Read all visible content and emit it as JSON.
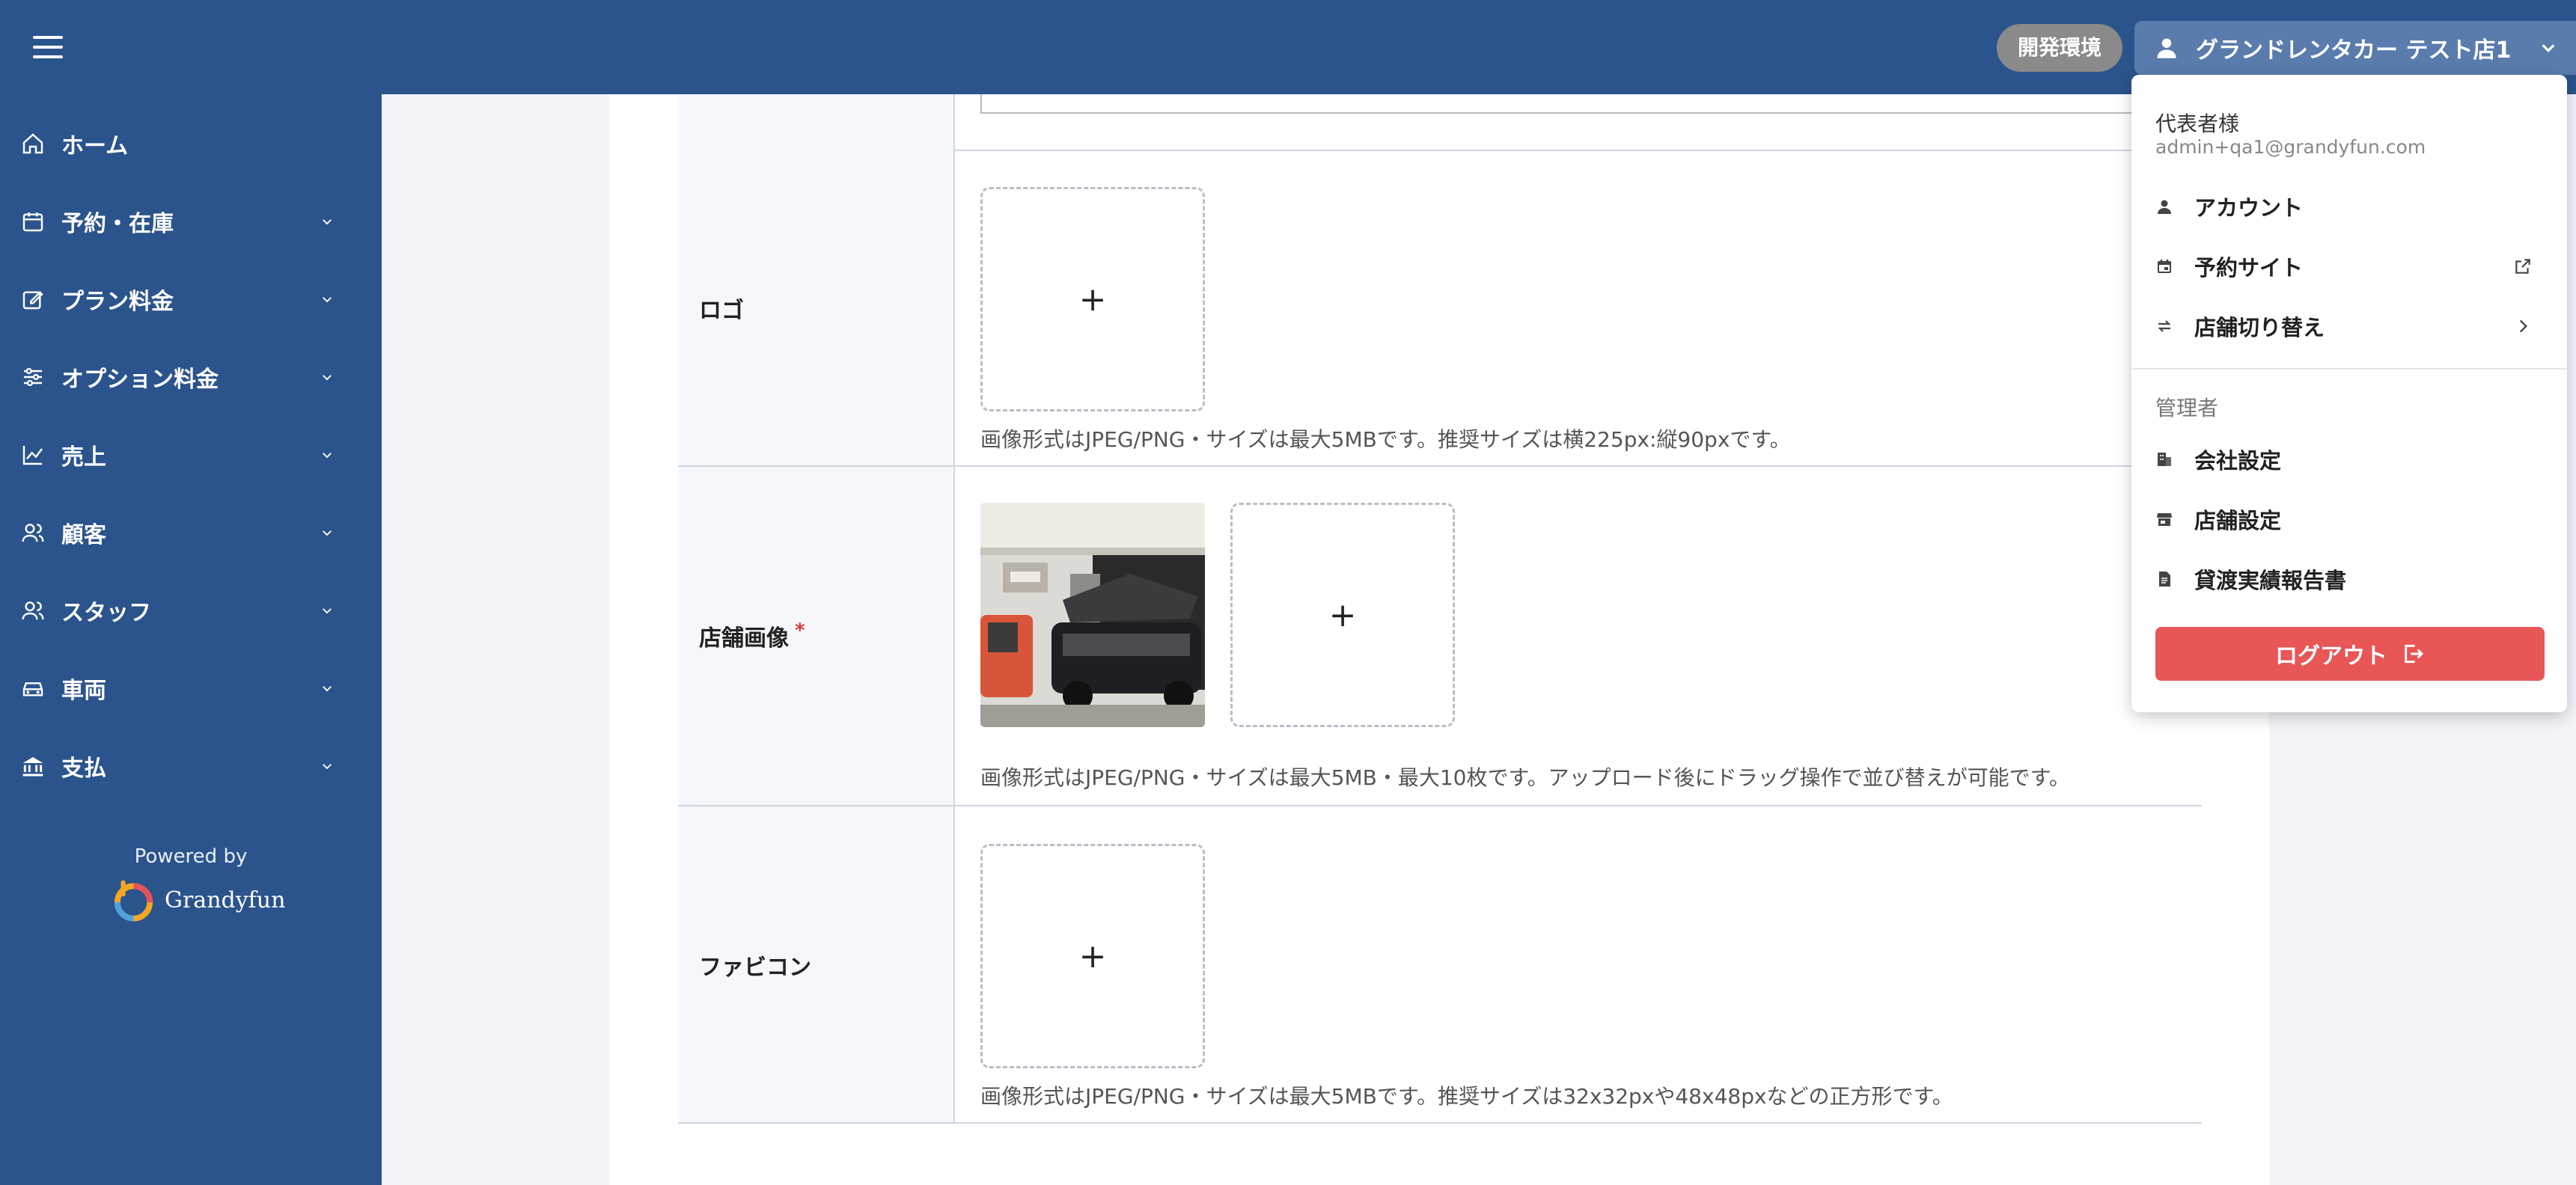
{
  "header": {
    "env_badge": "開発環境",
    "store_name": "グランドレンタカー テスト店1"
  },
  "sidebar": {
    "items": [
      {
        "label": "ホーム",
        "icon": "home-icon"
      },
      {
        "label": "予約・在庫",
        "icon": "calendar-icon"
      },
      {
        "label": "プラン料金",
        "icon": "edit-icon"
      },
      {
        "label": "オプション料金",
        "icon": "sliders-icon"
      },
      {
        "label": "売上",
        "icon": "chart-line-icon"
      },
      {
        "label": "顧客",
        "icon": "users-icon"
      },
      {
        "label": "スタッフ",
        "icon": "staff-icon"
      },
      {
        "label": "車両",
        "icon": "car-icon"
      },
      {
        "label": "支払",
        "icon": "bank-icon"
      }
    ],
    "powered_by": "Powered by",
    "brand": "Grandyfun"
  },
  "form": {
    "logo": {
      "label": "ロゴ",
      "hint": "画像形式はJPEG/PNG・サイズは最大5MBです。推奨サイズは横225px:縦90pxです。"
    },
    "store_image": {
      "label": "店舗画像",
      "required": "*",
      "hint": "画像形式はJPEG/PNG・サイズは最大5MB・最大10枚です。アップロード後にドラッグ操作で並び替えが可能です。"
    },
    "favicon": {
      "label": "ファビコン",
      "hint": "画像形式はJPEG/PNG・サイズは最大5MBです。推奨サイズは32x32pxや48x48pxなどの正方形です。"
    },
    "upload_plus": "+"
  },
  "dropdown": {
    "user_name": "代表者様",
    "email": "admin+qa1@grandyfun.com",
    "items": [
      {
        "label": "アカウント"
      },
      {
        "label": "予約サイト"
      },
      {
        "label": "店舗切り替え"
      }
    ],
    "admin_section": "管理者",
    "admin_items": [
      {
        "label": "会社設定"
      },
      {
        "label": "店舗設定"
      },
      {
        "label": "貸渡実績報告書"
      }
    ],
    "logout": "ログアウト"
  },
  "colors": {
    "primary": "#2b548c",
    "logout": "#e85656",
    "env_badge": "#8a8a8a"
  }
}
